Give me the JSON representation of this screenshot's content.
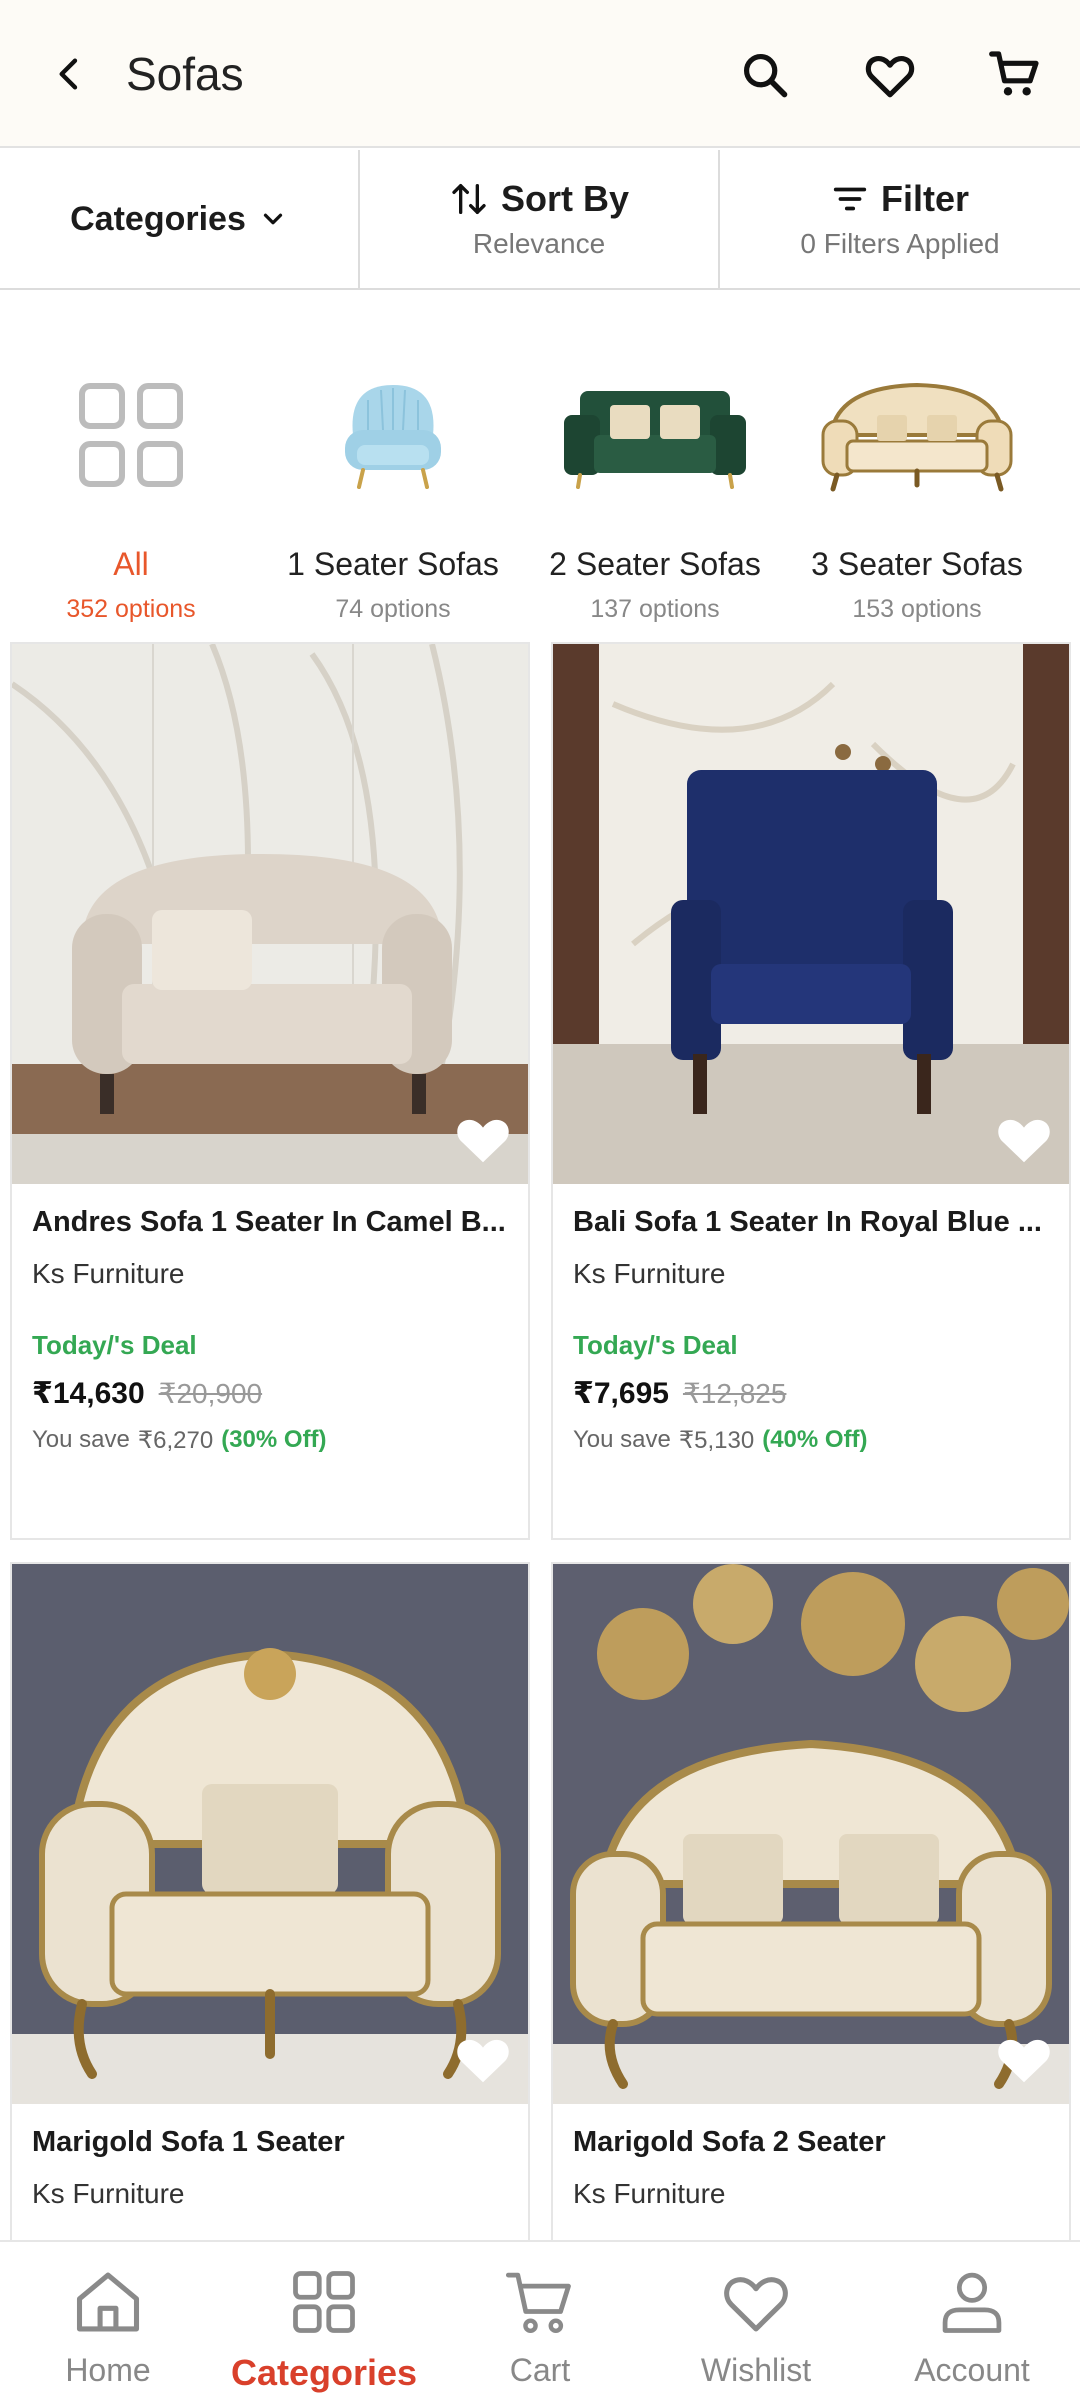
{
  "header": {
    "title": "Sofas",
    "icons": [
      "back-arrow-icon",
      "search-icon",
      "heart-icon",
      "cart-icon"
    ]
  },
  "toolbar": {
    "categories_label": "Categories",
    "sort_label": "Sort By",
    "sort_value": "Relevance",
    "filter_label": "Filter",
    "filter_value": "0 Filters Applied"
  },
  "categories": [
    {
      "label": "All",
      "count": "352 options",
      "active": true
    },
    {
      "label": "1 Seater Sofas",
      "count": "74 options"
    },
    {
      "label": "2 Seater Sofas",
      "count": "137 options"
    },
    {
      "label": "3 Seater Sofas",
      "count": "153 options"
    }
  ],
  "products": [
    {
      "name": "Andres Sofa 1 Seater In Camel B...",
      "brand": "Ks Furniture",
      "deal": "Today/'s Deal",
      "price": "₹14,630",
      "mrp": "₹20,900",
      "save_prefix": "You save",
      "save": "₹6,270",
      "off": "(30% Off)"
    },
    {
      "name": "Bali Sofa 1 Seater In Royal Blue ...",
      "brand": "Ks Furniture",
      "deal": "Today/'s Deal",
      "price": "₹7,695",
      "mrp": "₹12,825",
      "save_prefix": "You save",
      "save": "₹5,130",
      "off": "(40% Off)"
    },
    {
      "name": "Marigold Sofa 1 Seater",
      "brand": "Ks Furniture"
    },
    {
      "name": "Marigold Sofa 2 Seater",
      "brand": "Ks Furniture"
    }
  ],
  "bottom_nav": [
    {
      "label": "Home",
      "icon": "home-icon"
    },
    {
      "label": "Categories",
      "icon": "categories-icon",
      "active": true
    },
    {
      "label": "Cart",
      "icon": "cart-icon"
    },
    {
      "label": "Wishlist",
      "icon": "heart-icon"
    },
    {
      "label": "Account",
      "icon": "account-icon"
    }
  ],
  "colors": {
    "accent": "#e8572b",
    "nav_active": "#d9402b",
    "deal_green": "#34a853",
    "header_bg": "#fdfbf6"
  }
}
